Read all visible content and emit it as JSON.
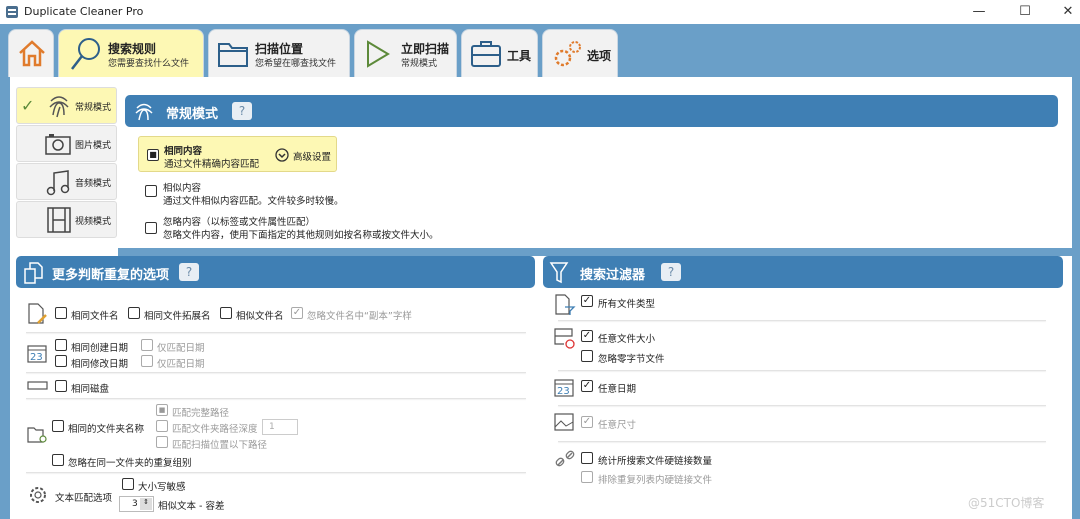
{
  "window": {
    "title": "Duplicate Cleaner Pro",
    "minimize": "—",
    "maximize": "☐",
    "close": "✕"
  },
  "tabs": [
    {
      "icon": "home-icon"
    },
    {
      "label": "搜索规则",
      "sub": "您需要查找什么文件"
    },
    {
      "label": "扫描位置",
      "sub": "您希望在哪查找文件"
    },
    {
      "label": "立即扫描",
      "sub": "常规模式"
    },
    {
      "label": "工具"
    },
    {
      "label": "选项"
    }
  ],
  "modes": [
    {
      "label": "常规模式",
      "check": "✓"
    },
    {
      "label": "图片模式"
    },
    {
      "label": "音频模式"
    },
    {
      "label": "视频模式"
    }
  ],
  "mode_panel": {
    "title": "常规模式",
    "help": "?",
    "options": [
      {
        "title": "相同内容",
        "desc": "通过文件精确内容匹配",
        "selected": true
      },
      {
        "title": "相似内容",
        "desc": "通过文件相似内容匹配。文件较多时较慢。"
      },
      {
        "title": "忽略内容（以标签或文件属性匹配）",
        "desc": "忽略文件内容，使用下面指定的其他规则如按名称或按文件大小。"
      }
    ],
    "advanced": "高级设置"
  },
  "more_options": {
    "title": "更多判断重复的选项",
    "help": "?",
    "same_name": "相同文件名",
    "same_ext": "相同文件拓展名",
    "similar_name": "相似文件名",
    "ignore_copy": "忽略文件名中“副本”字样",
    "same_created": "相同创建日期",
    "same_modified": "相同修改日期",
    "date_only_1": "仅匹配日期",
    "date_only_2": "仅匹配日期",
    "same_disk": "相同磁盘",
    "same_folder": "相同的文件夹名称",
    "match_full_path": "匹配完整路径",
    "match_depth": "匹配文件夹路径深度",
    "depth_value": "1",
    "match_below": "匹配扫描位置以下路径",
    "ignore_same_folder": "忽略在同一文件夹的重复组别",
    "text_match": "文本匹配选项",
    "case_sensitive": "大小写敏感",
    "similar_value": "3",
    "similar_text": "相似文本 - 容差"
  },
  "filters": {
    "title": "搜索过滤器",
    "help": "?",
    "all_types": "所有文件类型",
    "any_size": "任意文件大小",
    "ignore_zero": "忽略零字节文件",
    "any_date": "任意日期",
    "any_dimension": "任意尺寸",
    "count_hardlinks": "统计所搜索文件硬链接数量",
    "exclude_hardlinks": "排除重复列表内硬链接文件"
  },
  "watermark": "@51CTO博客",
  "colors": {
    "accent": "#3f7fb4",
    "active_tab": "#fdf8b4",
    "background": "#6a9fc8"
  }
}
